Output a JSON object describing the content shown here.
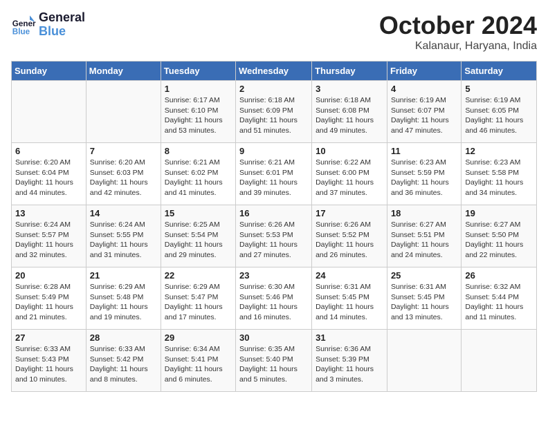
{
  "header": {
    "logo_line1": "General",
    "logo_line2": "Blue",
    "month": "October 2024",
    "location": "Kalanaur, Haryana, India"
  },
  "weekdays": [
    "Sunday",
    "Monday",
    "Tuesday",
    "Wednesday",
    "Thursday",
    "Friday",
    "Saturday"
  ],
  "weeks": [
    [
      {
        "day": "",
        "sunrise": "",
        "sunset": "",
        "daylight": ""
      },
      {
        "day": "",
        "sunrise": "",
        "sunset": "",
        "daylight": ""
      },
      {
        "day": "1",
        "sunrise": "Sunrise: 6:17 AM",
        "sunset": "Sunset: 6:10 PM",
        "daylight": "Daylight: 11 hours and 53 minutes."
      },
      {
        "day": "2",
        "sunrise": "Sunrise: 6:18 AM",
        "sunset": "Sunset: 6:09 PM",
        "daylight": "Daylight: 11 hours and 51 minutes."
      },
      {
        "day": "3",
        "sunrise": "Sunrise: 6:18 AM",
        "sunset": "Sunset: 6:08 PM",
        "daylight": "Daylight: 11 hours and 49 minutes."
      },
      {
        "day": "4",
        "sunrise": "Sunrise: 6:19 AM",
        "sunset": "Sunset: 6:07 PM",
        "daylight": "Daylight: 11 hours and 47 minutes."
      },
      {
        "day": "5",
        "sunrise": "Sunrise: 6:19 AM",
        "sunset": "Sunset: 6:05 PM",
        "daylight": "Daylight: 11 hours and 46 minutes."
      }
    ],
    [
      {
        "day": "6",
        "sunrise": "Sunrise: 6:20 AM",
        "sunset": "Sunset: 6:04 PM",
        "daylight": "Daylight: 11 hours and 44 minutes."
      },
      {
        "day": "7",
        "sunrise": "Sunrise: 6:20 AM",
        "sunset": "Sunset: 6:03 PM",
        "daylight": "Daylight: 11 hours and 42 minutes."
      },
      {
        "day": "8",
        "sunrise": "Sunrise: 6:21 AM",
        "sunset": "Sunset: 6:02 PM",
        "daylight": "Daylight: 11 hours and 41 minutes."
      },
      {
        "day": "9",
        "sunrise": "Sunrise: 6:21 AM",
        "sunset": "Sunset: 6:01 PM",
        "daylight": "Daylight: 11 hours and 39 minutes."
      },
      {
        "day": "10",
        "sunrise": "Sunrise: 6:22 AM",
        "sunset": "Sunset: 6:00 PM",
        "daylight": "Daylight: 11 hours and 37 minutes."
      },
      {
        "day": "11",
        "sunrise": "Sunrise: 6:23 AM",
        "sunset": "Sunset: 5:59 PM",
        "daylight": "Daylight: 11 hours and 36 minutes."
      },
      {
        "day": "12",
        "sunrise": "Sunrise: 6:23 AM",
        "sunset": "Sunset: 5:58 PM",
        "daylight": "Daylight: 11 hours and 34 minutes."
      }
    ],
    [
      {
        "day": "13",
        "sunrise": "Sunrise: 6:24 AM",
        "sunset": "Sunset: 5:57 PM",
        "daylight": "Daylight: 11 hours and 32 minutes."
      },
      {
        "day": "14",
        "sunrise": "Sunrise: 6:24 AM",
        "sunset": "Sunset: 5:55 PM",
        "daylight": "Daylight: 11 hours and 31 minutes."
      },
      {
        "day": "15",
        "sunrise": "Sunrise: 6:25 AM",
        "sunset": "Sunset: 5:54 PM",
        "daylight": "Daylight: 11 hours and 29 minutes."
      },
      {
        "day": "16",
        "sunrise": "Sunrise: 6:26 AM",
        "sunset": "Sunset: 5:53 PM",
        "daylight": "Daylight: 11 hours and 27 minutes."
      },
      {
        "day": "17",
        "sunrise": "Sunrise: 6:26 AM",
        "sunset": "Sunset: 5:52 PM",
        "daylight": "Daylight: 11 hours and 26 minutes."
      },
      {
        "day": "18",
        "sunrise": "Sunrise: 6:27 AM",
        "sunset": "Sunset: 5:51 PM",
        "daylight": "Daylight: 11 hours and 24 minutes."
      },
      {
        "day": "19",
        "sunrise": "Sunrise: 6:27 AM",
        "sunset": "Sunset: 5:50 PM",
        "daylight": "Daylight: 11 hours and 22 minutes."
      }
    ],
    [
      {
        "day": "20",
        "sunrise": "Sunrise: 6:28 AM",
        "sunset": "Sunset: 5:49 PM",
        "daylight": "Daylight: 11 hours and 21 minutes."
      },
      {
        "day": "21",
        "sunrise": "Sunrise: 6:29 AM",
        "sunset": "Sunset: 5:48 PM",
        "daylight": "Daylight: 11 hours and 19 minutes."
      },
      {
        "day": "22",
        "sunrise": "Sunrise: 6:29 AM",
        "sunset": "Sunset: 5:47 PM",
        "daylight": "Daylight: 11 hours and 17 minutes."
      },
      {
        "day": "23",
        "sunrise": "Sunrise: 6:30 AM",
        "sunset": "Sunset: 5:46 PM",
        "daylight": "Daylight: 11 hours and 16 minutes."
      },
      {
        "day": "24",
        "sunrise": "Sunrise: 6:31 AM",
        "sunset": "Sunset: 5:45 PM",
        "daylight": "Daylight: 11 hours and 14 minutes."
      },
      {
        "day": "25",
        "sunrise": "Sunrise: 6:31 AM",
        "sunset": "Sunset: 5:45 PM",
        "daylight": "Daylight: 11 hours and 13 minutes."
      },
      {
        "day": "26",
        "sunrise": "Sunrise: 6:32 AM",
        "sunset": "Sunset: 5:44 PM",
        "daylight": "Daylight: 11 hours and 11 minutes."
      }
    ],
    [
      {
        "day": "27",
        "sunrise": "Sunrise: 6:33 AM",
        "sunset": "Sunset: 5:43 PM",
        "daylight": "Daylight: 11 hours and 10 minutes."
      },
      {
        "day": "28",
        "sunrise": "Sunrise: 6:33 AM",
        "sunset": "Sunset: 5:42 PM",
        "daylight": "Daylight: 11 hours and 8 minutes."
      },
      {
        "day": "29",
        "sunrise": "Sunrise: 6:34 AM",
        "sunset": "Sunset: 5:41 PM",
        "daylight": "Daylight: 11 hours and 6 minutes."
      },
      {
        "day": "30",
        "sunrise": "Sunrise: 6:35 AM",
        "sunset": "Sunset: 5:40 PM",
        "daylight": "Daylight: 11 hours and 5 minutes."
      },
      {
        "day": "31",
        "sunrise": "Sunrise: 6:36 AM",
        "sunset": "Sunset: 5:39 PM",
        "daylight": "Daylight: 11 hours and 3 minutes."
      },
      {
        "day": "",
        "sunrise": "",
        "sunset": "",
        "daylight": ""
      },
      {
        "day": "",
        "sunrise": "",
        "sunset": "",
        "daylight": ""
      }
    ]
  ]
}
